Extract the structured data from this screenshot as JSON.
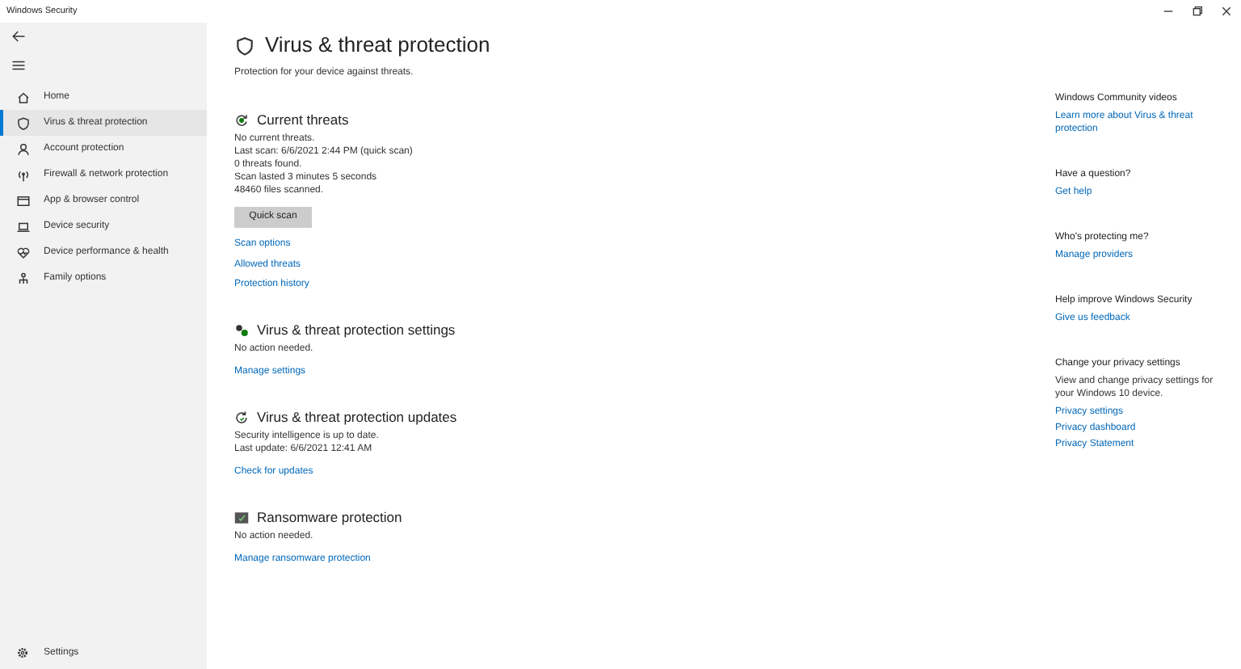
{
  "window": {
    "title": "Windows Security"
  },
  "sidebar": {
    "items": [
      {
        "label": "Home",
        "selected": false
      },
      {
        "label": "Virus & threat protection",
        "selected": true
      },
      {
        "label": "Account protection",
        "selected": false
      },
      {
        "label": "Firewall & network protection",
        "selected": false
      },
      {
        "label": "App & browser control",
        "selected": false
      },
      {
        "label": "Device security",
        "selected": false
      },
      {
        "label": "Device performance & health",
        "selected": false
      },
      {
        "label": "Family options",
        "selected": false
      }
    ],
    "settings": {
      "label": "Settings"
    }
  },
  "page": {
    "title": "Virus & threat protection",
    "subtitle": "Protection for your device against threats."
  },
  "sections": [
    {
      "title": "Current threats",
      "lines": [
        "No current threats.",
        "Last scan: 6/6/2021 2:44 PM (quick scan)",
        "0 threats found.",
        "Scan lasted 3 minutes 5 seconds",
        "48460 files scanned."
      ],
      "button": "Quick scan",
      "links": [
        "Scan options",
        "Allowed threats",
        "Protection history"
      ]
    },
    {
      "title": "Virus & threat protection settings",
      "lines": [
        "No action needed."
      ],
      "links": [
        "Manage settings"
      ]
    },
    {
      "title": "Virus & threat protection updates",
      "lines": [
        "Security intelligence is up to date.",
        "Last update: 6/6/2021 12:41 AM"
      ],
      "links": [
        "Check for updates"
      ]
    },
    {
      "title": "Ransomware protection",
      "lines": [
        "No action needed."
      ],
      "links": [
        "Manage ransomware protection"
      ]
    }
  ],
  "aside": [
    {
      "heading": "Windows Community videos",
      "links": [
        "Learn more about Virus & threat protection"
      ]
    },
    {
      "heading": "Have a question?",
      "links": [
        "Get help"
      ]
    },
    {
      "heading": "Who's protecting me?",
      "links": [
        "Manage providers"
      ]
    },
    {
      "heading": "Help improve Windows Security",
      "links": [
        "Give us feedback"
      ]
    },
    {
      "heading": "Change your privacy settings",
      "text": "View and change privacy settings for your Windows 10 device.",
      "links": [
        "Privacy settings",
        "Privacy dashboard",
        "Privacy Statement"
      ]
    }
  ]
}
